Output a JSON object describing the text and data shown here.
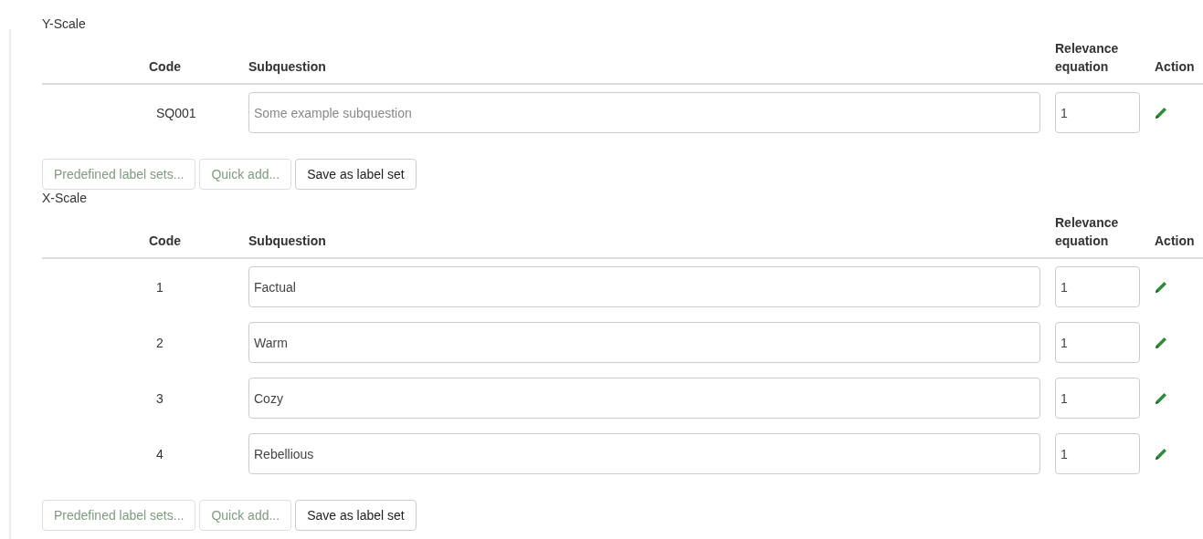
{
  "scales": [
    {
      "title": "Y-Scale",
      "columns": [
        "Code",
        "Subquestion",
        "Relevance equation",
        "Action"
      ],
      "rows": [
        {
          "code": "SQ001",
          "subquestion": {
            "placeholder": "Some example subquestion"
          },
          "relevance": "1"
        }
      ],
      "buttons": [
        {
          "label": "Predefined label sets...",
          "disabled": true
        },
        {
          "label": "Quick add...",
          "disabled": true
        },
        {
          "label": "Save as label set",
          "disabled": false
        }
      ]
    },
    {
      "title": "X-Scale",
      "columns": [
        "Code",
        "Subquestion",
        "Relevance equation",
        "Action"
      ],
      "rows": [
        {
          "code": "1",
          "subquestion": {
            "value": "Factual"
          },
          "relevance": "1"
        },
        {
          "code": "2",
          "subquestion": {
            "value": "Warm"
          },
          "relevance": "1"
        },
        {
          "code": "3",
          "subquestion": {
            "value": "Cozy"
          },
          "relevance": "1"
        },
        {
          "code": "4",
          "subquestion": {
            "value": "Rebellious"
          },
          "relevance": "1"
        }
      ],
      "buttons": [
        {
          "label": "Predefined label sets...",
          "disabled": true
        },
        {
          "label": "Quick add...",
          "disabled": true
        },
        {
          "label": "Save as label set",
          "disabled": false
        }
      ]
    }
  ]
}
